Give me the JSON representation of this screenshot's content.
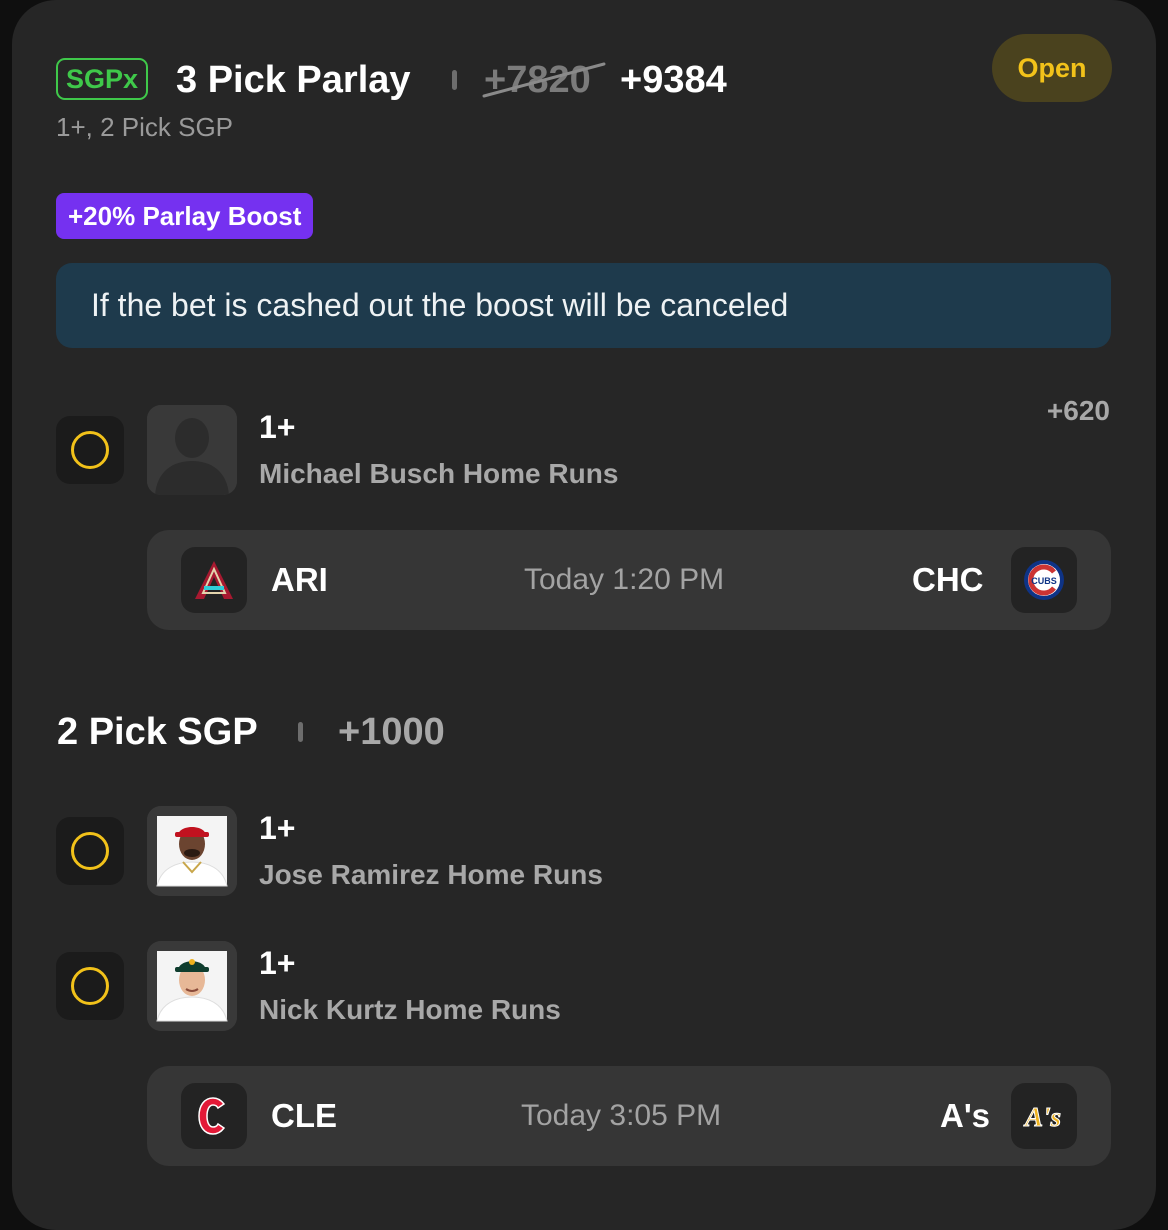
{
  "header": {
    "badge": "SGPx",
    "title": "3 Pick Parlay",
    "old_odds": "+7820",
    "new_odds": "+9384",
    "subtitle": "1+, 2 Pick SGP",
    "status": "Open"
  },
  "boost": {
    "label": "+20% Parlay Boost",
    "notice": "If the bet is cashed out the boost will be canceled"
  },
  "legs": [
    {
      "line": "1+",
      "market": "Michael Busch Home Runs",
      "odds": "+620"
    },
    {
      "line": "1+",
      "market": "Jose Ramirez Home Runs"
    },
    {
      "line": "1+",
      "market": "Nick Kurtz Home Runs"
    }
  ],
  "games": [
    {
      "away": "ARI",
      "time": "Today 1:20 PM",
      "home": "CHC"
    },
    {
      "away": "CLE",
      "time": "Today 3:05 PM",
      "home": "A's"
    }
  ],
  "sgp": {
    "title": "2 Pick SGP",
    "odds": "+1000"
  },
  "logos": {
    "chc_text": "CUBS",
    "oak_text": "A's"
  },
  "colors": {
    "card_bg": "#262626",
    "sgpx_green": "#3fc84a",
    "open_yellow": "#f2c21a",
    "boost_purple": "#7531f0",
    "notice_bg": "#1e3a4c"
  }
}
